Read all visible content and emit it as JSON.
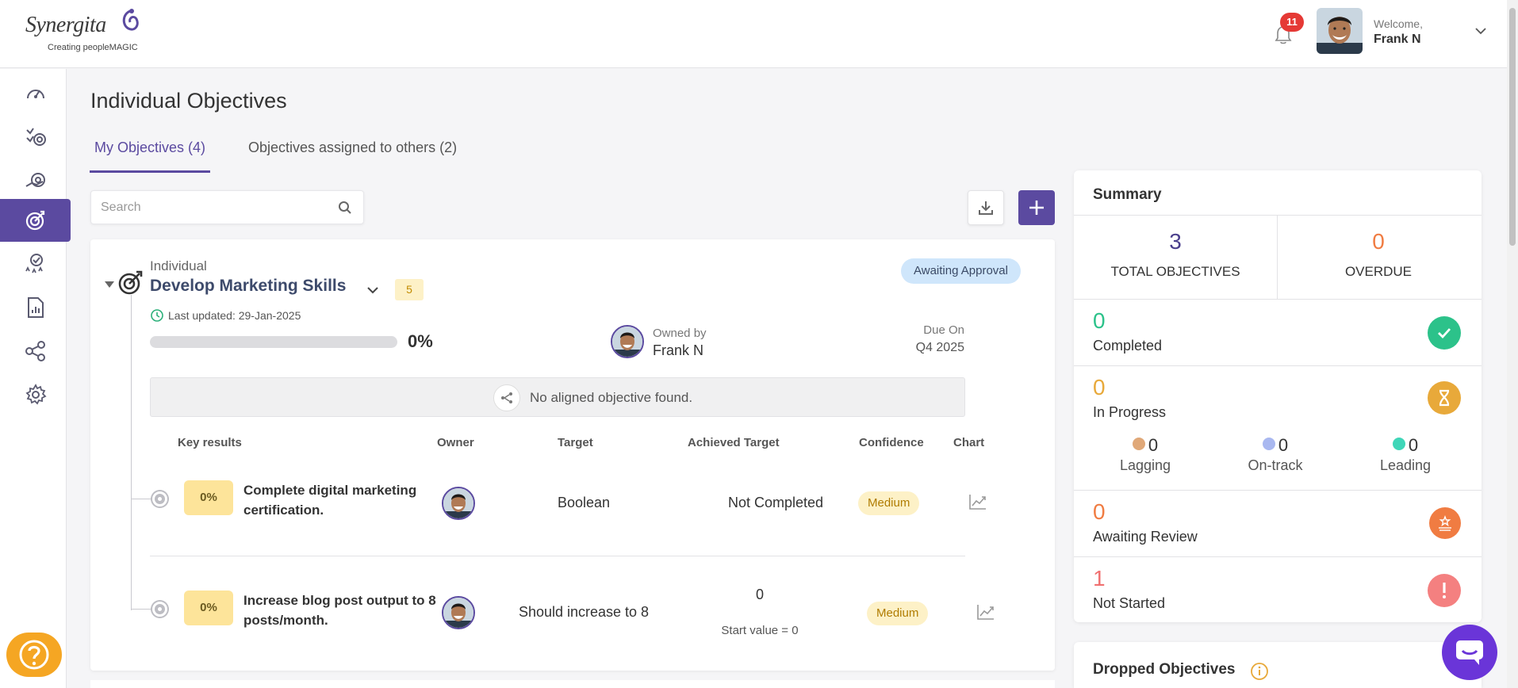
{
  "header": {
    "logo_text": "Synergita",
    "logo_tagline": "Creating peopleMAGIC",
    "notification_count": "11",
    "welcome": "Welcome,",
    "user_name": "Frank N"
  },
  "sidebar": {
    "items": [
      {
        "icon": "dashboard-gauge-icon"
      },
      {
        "icon": "goals-checklist-icon"
      },
      {
        "icon": "team-objectives-icon"
      },
      {
        "icon": "individual-objectives-icon",
        "active": true
      },
      {
        "icon": "recognition-award-icon"
      },
      {
        "icon": "reports-icon"
      },
      {
        "icon": "network-icon"
      },
      {
        "icon": "settings-gear-icon"
      }
    ],
    "active_color": "#5b4aa0"
  },
  "page": {
    "title": "Individual Objectives",
    "tabs": [
      {
        "label": "My Objectives (4)",
        "active": true
      },
      {
        "label": "Objectives assigned to others (2)",
        "active": false
      }
    ],
    "search_placeholder": "Search"
  },
  "objective": {
    "type": "Individual",
    "title": "Develop Marketing Skills",
    "key_result_count": "5",
    "status": "Awaiting Approval",
    "last_updated": "Last updated: 29-Jan-2025",
    "progress": 0,
    "progress_label": "0%",
    "owned_by_label": "Owned by",
    "owner": "Frank N",
    "due_label": "Due On",
    "due_value": "Q4 2025",
    "aligned_message": "No aligned objective found.",
    "columns": [
      "Key results",
      "Owner",
      "Target",
      "Achieved Target",
      "Confidence",
      "Chart"
    ],
    "key_results": [
      {
        "pct": "0%",
        "title": "Complete digital marketing certification.",
        "target": "Boolean",
        "achieved": "Not Completed",
        "achieved_sub": "",
        "confidence": "Medium"
      },
      {
        "pct": "0%",
        "title": "Increase blog post output to 8 posts/month.",
        "target": "Should increase to 8",
        "achieved": "0",
        "achieved_sub": "Start value = 0",
        "confidence": "Medium"
      }
    ]
  },
  "summary": {
    "title": "Summary",
    "total_value": "3",
    "total_label": "TOTAL OBJECTIVES",
    "overdue_value": "0",
    "overdue_label": "OVERDUE",
    "completed_value": "0",
    "completed_label": "Completed",
    "in_progress_value": "0",
    "in_progress_label": "In Progress",
    "lagging_value": "0",
    "lagging_label": "Lagging",
    "ontrack_value": "0",
    "ontrack_label": "On-track",
    "leading_value": "0",
    "leading_label": "Leading",
    "awaiting_review_value": "0",
    "awaiting_review_label": "Awaiting Review",
    "not_started_value": "1",
    "not_started_label": "Not Started",
    "colors": {
      "total": "#4a3f8c",
      "overdue": "#f07c42",
      "completed": "#2cc28a",
      "in_progress": "#e8a93a",
      "lagging": "#e0a878",
      "ontrack": "#a9b8f0",
      "leading": "#3fd6b8",
      "awaiting_review": "#f07c42",
      "not_started": "#f07070"
    }
  },
  "dropped": {
    "title": "Dropped Objectives"
  }
}
